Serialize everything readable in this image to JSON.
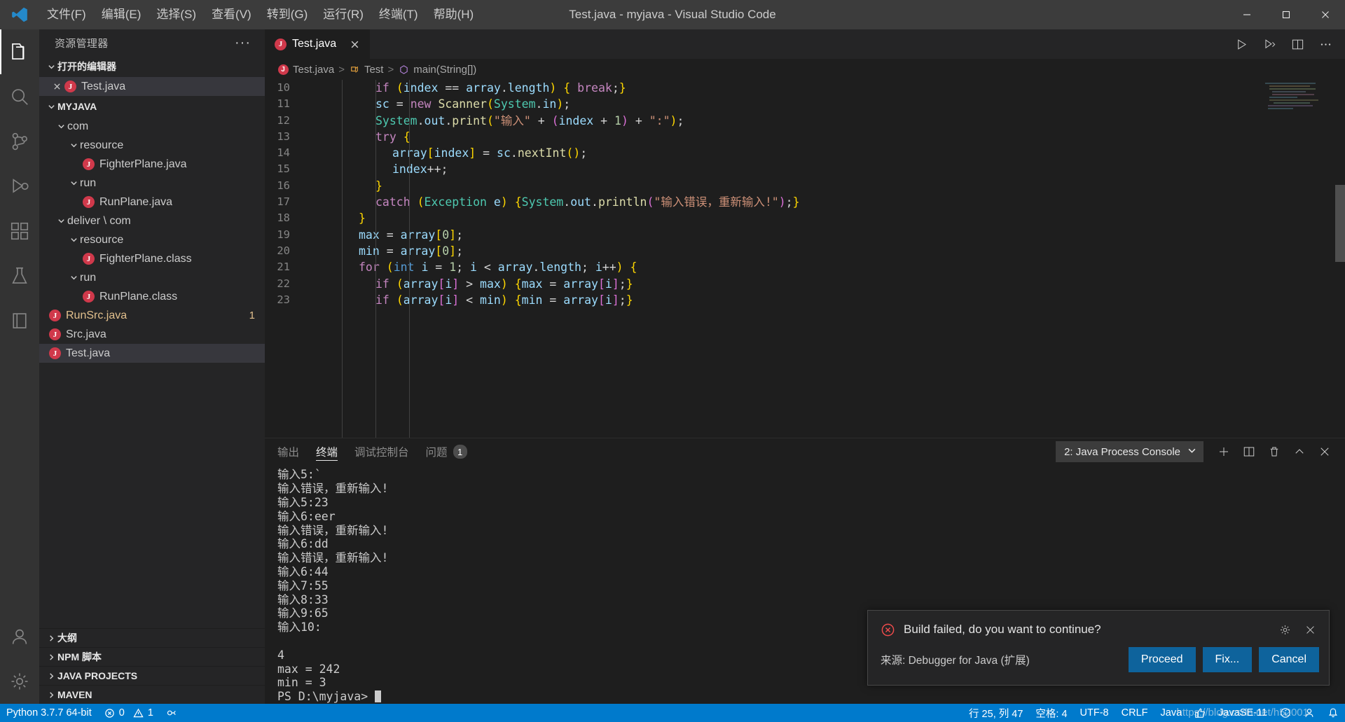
{
  "titlebar": {
    "window_title": "Test.java - myjava - Visual Studio Code",
    "menus": [
      "文件(F)",
      "编辑(E)",
      "选择(S)",
      "查看(V)",
      "转到(G)",
      "运行(R)",
      "终端(T)",
      "帮助(H)"
    ],
    "controls": [
      "minimize",
      "maximize",
      "close"
    ]
  },
  "activitybar": {
    "items": [
      {
        "name": "explorer",
        "icon": "files-icon",
        "active": true
      },
      {
        "name": "search",
        "icon": "search-icon",
        "active": false
      },
      {
        "name": "source-control",
        "icon": "source-control-icon",
        "active": false
      },
      {
        "name": "run-debug",
        "icon": "run-debug-icon",
        "active": false
      },
      {
        "name": "extensions",
        "icon": "extensions-icon",
        "active": false
      },
      {
        "name": "testing",
        "icon": "beaker-icon",
        "active": false
      },
      {
        "name": "java-projects",
        "icon": "book-icon",
        "active": false
      }
    ],
    "bottom": [
      {
        "name": "accounts",
        "icon": "account-icon"
      },
      {
        "name": "settings",
        "icon": "gear-icon"
      }
    ]
  },
  "sidebar": {
    "title": "资源管理器",
    "more_actions": "···",
    "open_editors": {
      "label": "打开的编辑器",
      "expanded": true,
      "items": [
        {
          "label": "Test.java",
          "icon": "java-file-icon",
          "selected": true,
          "closable": true
        }
      ]
    },
    "workspace": {
      "label": "MYJAVA",
      "expanded": true,
      "items": [
        {
          "label": "com",
          "type": "folder",
          "depth": 1,
          "expanded": true
        },
        {
          "label": "resource",
          "type": "folder",
          "depth": 2,
          "expanded": true
        },
        {
          "label": "FighterPlane.java",
          "type": "java",
          "depth": 3
        },
        {
          "label": "run",
          "type": "folder",
          "depth": 2,
          "expanded": true
        },
        {
          "label": "RunPlane.java",
          "type": "java",
          "depth": 3
        },
        {
          "label": "deliver \\ com",
          "type": "folder",
          "depth": 1,
          "expanded": true
        },
        {
          "label": "resource",
          "type": "folder",
          "depth": 2,
          "expanded": true
        },
        {
          "label": "FighterPlane.class",
          "type": "java",
          "depth": 3
        },
        {
          "label": "run",
          "type": "folder",
          "depth": 2,
          "expanded": true
        },
        {
          "label": "RunPlane.class",
          "type": "java",
          "depth": 3
        },
        {
          "label": "RunSrc.java",
          "type": "java",
          "depth": 1,
          "modified": true,
          "badge": "1"
        },
        {
          "label": "Src.java",
          "type": "java",
          "depth": 1
        },
        {
          "label": "Test.java",
          "type": "java",
          "depth": 1,
          "selected": true
        }
      ]
    },
    "bottom_sections": [
      {
        "label": "大纲",
        "expanded": false
      },
      {
        "label": "NPM 脚本",
        "expanded": false
      },
      {
        "label": "JAVA PROJECTS",
        "expanded": false
      },
      {
        "label": "MAVEN",
        "expanded": false
      }
    ]
  },
  "editor": {
    "tab": {
      "label": "Test.java",
      "icon": "java-file-icon",
      "active": true
    },
    "tab_actions": [
      "run-icon",
      "run-debug-icon",
      "split-editor-icon",
      "more-actions-icon"
    ],
    "breadcrumb": [
      {
        "label": "Test.java",
        "icon": "java-file-icon"
      },
      {
        "label": "Test",
        "icon": "class-icon"
      },
      {
        "label": "main(String[])",
        "icon": "method-icon"
      }
    ],
    "first_line_number": 10,
    "lines": [
      {
        "n": 10,
        "indent": 4,
        "tokens": [
          {
            "t": "if",
            "c": "k"
          },
          {
            "t": " ",
            "c": "pl"
          },
          {
            "t": "(",
            "c": "pn"
          },
          {
            "t": "index",
            "c": "vr"
          },
          {
            "t": " == ",
            "c": "op"
          },
          {
            "t": "array",
            "c": "vr"
          },
          {
            "t": ".",
            "c": "op"
          },
          {
            "t": "length",
            "c": "vr"
          },
          {
            "t": ")",
            "c": "pn"
          },
          {
            "t": " ",
            "c": "pl"
          },
          {
            "t": "{",
            "c": "pn"
          },
          {
            "t": " ",
            "c": "pl"
          },
          {
            "t": "break",
            "c": "k"
          },
          {
            "t": ";",
            "c": "op"
          },
          {
            "t": "}",
            "c": "pn"
          }
        ]
      },
      {
        "n": 11,
        "indent": 4,
        "tokens": [
          {
            "t": "sc",
            "c": "vr"
          },
          {
            "t": " = ",
            "c": "op"
          },
          {
            "t": "new",
            "c": "k"
          },
          {
            "t": " ",
            "c": "pl"
          },
          {
            "t": "Scanner",
            "c": "fn"
          },
          {
            "t": "(",
            "c": "pn"
          },
          {
            "t": "System",
            "c": "ty"
          },
          {
            "t": ".",
            "c": "op"
          },
          {
            "t": "in",
            "c": "vr"
          },
          {
            "t": ")",
            "c": "pn"
          },
          {
            "t": ";",
            "c": "op"
          }
        ]
      },
      {
        "n": 12,
        "indent": 4,
        "tokens": [
          {
            "t": "System",
            "c": "ty"
          },
          {
            "t": ".",
            "c": "op"
          },
          {
            "t": "out",
            "c": "vr"
          },
          {
            "t": ".",
            "c": "op"
          },
          {
            "t": "print",
            "c": "fn"
          },
          {
            "t": "(",
            "c": "pn"
          },
          {
            "t": "\"输入\"",
            "c": "st"
          },
          {
            "t": " + ",
            "c": "op"
          },
          {
            "t": "(",
            "c": "pn2"
          },
          {
            "t": "index",
            "c": "vr"
          },
          {
            "t": " + ",
            "c": "op"
          },
          {
            "t": "1",
            "c": "nm"
          },
          {
            "t": ")",
            "c": "pn2"
          },
          {
            "t": " + ",
            "c": "op"
          },
          {
            "t": "\":\"",
            "c": "st"
          },
          {
            "t": ")",
            "c": "pn"
          },
          {
            "t": ";",
            "c": "op"
          }
        ]
      },
      {
        "n": 13,
        "indent": 4,
        "tokens": [
          {
            "t": "try",
            "c": "k"
          },
          {
            "t": " ",
            "c": "pl"
          },
          {
            "t": "{",
            "c": "pn"
          }
        ]
      },
      {
        "n": 14,
        "indent": 5,
        "tokens": [
          {
            "t": "array",
            "c": "vr"
          },
          {
            "t": "[",
            "c": "pn"
          },
          {
            "t": "index",
            "c": "vr"
          },
          {
            "t": "]",
            "c": "pn"
          },
          {
            "t": " = ",
            "c": "op"
          },
          {
            "t": "sc",
            "c": "vr"
          },
          {
            "t": ".",
            "c": "op"
          },
          {
            "t": "nextInt",
            "c": "fn"
          },
          {
            "t": "(",
            "c": "pn"
          },
          {
            "t": ")",
            "c": "pn"
          },
          {
            "t": ";",
            "c": "op"
          }
        ]
      },
      {
        "n": 15,
        "indent": 5,
        "tokens": [
          {
            "t": "index",
            "c": "vr"
          },
          {
            "t": "++;",
            "c": "op"
          }
        ]
      },
      {
        "n": 16,
        "indent": 4,
        "tokens": [
          {
            "t": "}",
            "c": "pn"
          }
        ]
      },
      {
        "n": 17,
        "indent": 4,
        "tokens": [
          {
            "t": "catch",
            "c": "k"
          },
          {
            "t": " ",
            "c": "pl"
          },
          {
            "t": "(",
            "c": "pn"
          },
          {
            "t": "Exception",
            "c": "ty"
          },
          {
            "t": " ",
            "c": "pl"
          },
          {
            "t": "e",
            "c": "vr"
          },
          {
            "t": ")",
            "c": "pn"
          },
          {
            "t": " ",
            "c": "pl"
          },
          {
            "t": "{",
            "c": "pn"
          },
          {
            "t": "System",
            "c": "ty"
          },
          {
            "t": ".",
            "c": "op"
          },
          {
            "t": "out",
            "c": "vr"
          },
          {
            "t": ".",
            "c": "op"
          },
          {
            "t": "println",
            "c": "fn"
          },
          {
            "t": "(",
            "c": "pn2"
          },
          {
            "t": "\"输入错误，重新输入!\"",
            "c": "st"
          },
          {
            "t": ")",
            "c": "pn2"
          },
          {
            "t": ";",
            "c": "op"
          },
          {
            "t": "}",
            "c": "pn"
          }
        ]
      },
      {
        "n": 18,
        "indent": 3,
        "tokens": [
          {
            "t": "}",
            "c": "pn"
          }
        ]
      },
      {
        "n": 19,
        "indent": 3,
        "tokens": [
          {
            "t": "max",
            "c": "vr"
          },
          {
            "t": " = ",
            "c": "op"
          },
          {
            "t": "array",
            "c": "vr"
          },
          {
            "t": "[",
            "c": "pn"
          },
          {
            "t": "0",
            "c": "nm"
          },
          {
            "t": "]",
            "c": "pn"
          },
          {
            "t": ";",
            "c": "op"
          }
        ]
      },
      {
        "n": 20,
        "indent": 3,
        "tokens": [
          {
            "t": "min",
            "c": "vr"
          },
          {
            "t": " = ",
            "c": "op"
          },
          {
            "t": "array",
            "c": "vr"
          },
          {
            "t": "[",
            "c": "pn"
          },
          {
            "t": "0",
            "c": "nm"
          },
          {
            "t": "]",
            "c": "pn"
          },
          {
            "t": ";",
            "c": "op"
          }
        ]
      },
      {
        "n": 21,
        "indent": 3,
        "tokens": [
          {
            "t": "for",
            "c": "k"
          },
          {
            "t": " ",
            "c": "pl"
          },
          {
            "t": "(",
            "c": "pn"
          },
          {
            "t": "int",
            "c": "kd"
          },
          {
            "t": " ",
            "c": "pl"
          },
          {
            "t": "i",
            "c": "vr"
          },
          {
            "t": " = ",
            "c": "op"
          },
          {
            "t": "1",
            "c": "nm"
          },
          {
            "t": "; ",
            "c": "op"
          },
          {
            "t": "i",
            "c": "vr"
          },
          {
            "t": " < ",
            "c": "op"
          },
          {
            "t": "array",
            "c": "vr"
          },
          {
            "t": ".",
            "c": "op"
          },
          {
            "t": "length",
            "c": "vr"
          },
          {
            "t": "; ",
            "c": "op"
          },
          {
            "t": "i",
            "c": "vr"
          },
          {
            "t": "++",
            "c": "op"
          },
          {
            "t": ")",
            "c": "pn"
          },
          {
            "t": " ",
            "c": "pl"
          },
          {
            "t": "{",
            "c": "pn"
          }
        ]
      },
      {
        "n": 22,
        "indent": 4,
        "tokens": [
          {
            "t": "if",
            "c": "k"
          },
          {
            "t": " ",
            "c": "pl"
          },
          {
            "t": "(",
            "c": "pn"
          },
          {
            "t": "array",
            "c": "vr"
          },
          {
            "t": "[",
            "c": "pn2"
          },
          {
            "t": "i",
            "c": "vr"
          },
          {
            "t": "]",
            "c": "pn2"
          },
          {
            "t": " > ",
            "c": "op"
          },
          {
            "t": "max",
            "c": "vr"
          },
          {
            "t": ")",
            "c": "pn"
          },
          {
            "t": " ",
            "c": "pl"
          },
          {
            "t": "{",
            "c": "pn"
          },
          {
            "t": "max",
            "c": "vr"
          },
          {
            "t": " = ",
            "c": "op"
          },
          {
            "t": "array",
            "c": "vr"
          },
          {
            "t": "[",
            "c": "pn2"
          },
          {
            "t": "i",
            "c": "vr"
          },
          {
            "t": "]",
            "c": "pn2"
          },
          {
            "t": ";",
            "c": "op"
          },
          {
            "t": "}",
            "c": "pn"
          }
        ]
      },
      {
        "n": 23,
        "indent": 4,
        "tokens": [
          {
            "t": "if",
            "c": "k"
          },
          {
            "t": " ",
            "c": "pl"
          },
          {
            "t": "(",
            "c": "pn"
          },
          {
            "t": "array",
            "c": "vr"
          },
          {
            "t": "[",
            "c": "pn2"
          },
          {
            "t": "i",
            "c": "vr"
          },
          {
            "t": "]",
            "c": "pn2"
          },
          {
            "t": " < ",
            "c": "op"
          },
          {
            "t": "min",
            "c": "vr"
          },
          {
            "t": ")",
            "c": "pn"
          },
          {
            "t": " ",
            "c": "pl"
          },
          {
            "t": "{",
            "c": "pn"
          },
          {
            "t": "min",
            "c": "vr"
          },
          {
            "t": " = ",
            "c": "op"
          },
          {
            "t": "array",
            "c": "vr"
          },
          {
            "t": "[",
            "c": "pn2"
          },
          {
            "t": "i",
            "c": "vr"
          },
          {
            "t": "]",
            "c": "pn2"
          },
          {
            "t": ";",
            "c": "op"
          },
          {
            "t": "}",
            "c": "pn"
          }
        ]
      }
    ]
  },
  "panel": {
    "tabs": [
      {
        "label": "输出",
        "active": false
      },
      {
        "label": "终端",
        "active": true
      },
      {
        "label": "调试控制台",
        "active": false
      },
      {
        "label": "问题",
        "active": false,
        "badge": "1"
      }
    ],
    "terminal_selector": "2: Java Process Console",
    "actions": [
      "new-terminal-icon",
      "split-terminal-icon",
      "kill-terminal-icon",
      "maximize-panel-icon",
      "close-panel-icon"
    ],
    "terminal_output": [
      "输入5:`",
      "输入错误，重新输入!",
      "输入5:23",
      "输入6:eer",
      "输入错误，重新输入!",
      "输入6:dd",
      "输入错误，重新输入!",
      "输入6:44",
      "输入7:55",
      "输入8:33",
      "输入9:65",
      "输入10:",
      "",
      "4",
      "max = 242",
      "min = 3"
    ],
    "prompt": "PS D:\\myjava> "
  },
  "notification": {
    "icon": "error-icon",
    "message": "Build failed, do you want to continue?",
    "source": "来源: Debugger for Java (扩展)",
    "gear_icon": "gear-icon",
    "close_icon": "close-icon",
    "buttons": [
      "Proceed",
      "Fix...",
      "Cancel"
    ],
    "accent": "#0e639c"
  },
  "statusbar": {
    "background": "#007acc",
    "left": [
      {
        "label": "Python 3.7.7 64-bit",
        "icon": null
      },
      {
        "label": "0",
        "icon": "error-icon"
      },
      {
        "label": "1",
        "icon": "warning-icon"
      },
      {
        "label": "",
        "icon": "debug-run-icon"
      }
    ],
    "right": [
      {
        "label": "行 25, 列 47",
        "icon": null
      },
      {
        "label": "空格: 4",
        "icon": null
      },
      {
        "label": "UTF-8",
        "icon": null
      },
      {
        "label": "CRLF",
        "icon": null
      },
      {
        "label": "Java",
        "icon": null
      },
      {
        "label": "",
        "icon": "thumbsup-icon"
      },
      {
        "label": "JavaSE-11",
        "icon": null
      },
      {
        "label": "",
        "icon": "info-icon"
      },
      {
        "label": "",
        "icon": "account-icon"
      },
      {
        "label": "",
        "icon": "bell-icon"
      }
    ],
    "watermark": "https://blog.csdn.net/h52001"
  }
}
